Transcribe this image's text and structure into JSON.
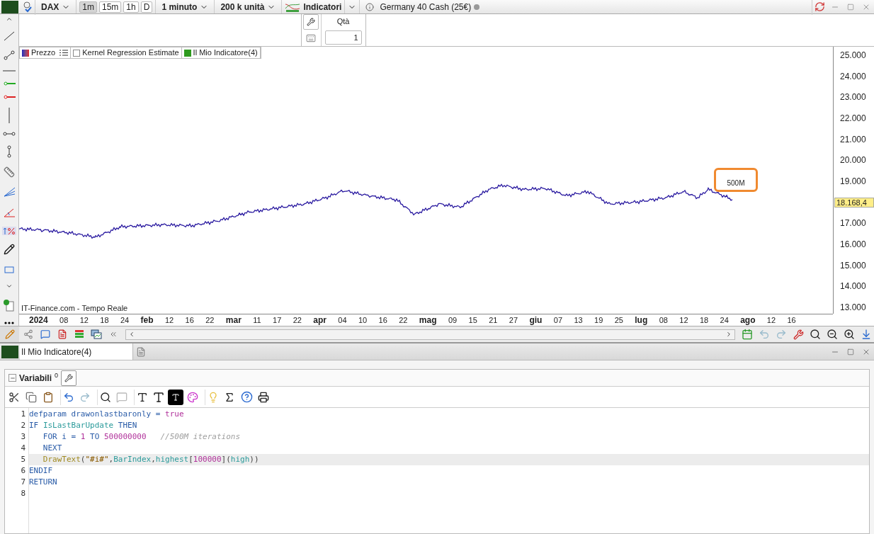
{
  "toolbar": {
    "symbol": "DAX",
    "timeframes": [
      {
        "label": "1m",
        "selected": true
      },
      {
        "label": "15m",
        "selected": false
      },
      {
        "label": "1h",
        "selected": false
      },
      {
        "label": "D",
        "selected": false
      }
    ],
    "interval": "1 minuto",
    "units": "200 k unità",
    "indicators": "Indicatori",
    "instrument": "Germany 40 Cash (25€)"
  },
  "order_panel": {
    "qty_label": "Qtà",
    "qty_value": "1"
  },
  "legend": [
    {
      "label": "Prezzo",
      "kind": "price"
    },
    {
      "label": "Kernel Regression Estimate",
      "kind": "hidden"
    },
    {
      "label": "Il Mio Indicatore(4)",
      "kind": "indicator",
      "color": "#2e9a1e"
    }
  ],
  "price_axis": [
    "25.000",
    "24.000",
    "23.000",
    "22.000",
    "21.000",
    "20.000",
    "19.000",
    "17.000",
    "16.000",
    "15.000",
    "14.000",
    "13.000"
  ],
  "current_price": "18.168,4",
  "annotation": "500M",
  "source": "IT-Finance.com - Tempo Reale",
  "time_axis": [
    {
      "text": "2024",
      "kind": "month"
    },
    {
      "text": "08",
      "kind": "day"
    },
    {
      "text": "12",
      "kind": "day"
    },
    {
      "text": "18",
      "kind": "day"
    },
    {
      "text": "24",
      "kind": "day"
    },
    {
      "text": "feb",
      "kind": "month"
    },
    {
      "text": "12",
      "kind": "day"
    },
    {
      "text": "16",
      "kind": "day"
    },
    {
      "text": "22",
      "kind": "day"
    },
    {
      "text": "mar",
      "kind": "month"
    },
    {
      "text": "11",
      "kind": "day"
    },
    {
      "text": "17",
      "kind": "day"
    },
    {
      "text": "22",
      "kind": "day"
    },
    {
      "text": "apr",
      "kind": "month"
    },
    {
      "text": "04",
      "kind": "day"
    },
    {
      "text": "10",
      "kind": "day"
    },
    {
      "text": "16",
      "kind": "day"
    },
    {
      "text": "22",
      "kind": "day"
    },
    {
      "text": "mag",
      "kind": "month"
    },
    {
      "text": "09",
      "kind": "day"
    },
    {
      "text": "15",
      "kind": "day"
    },
    {
      "text": "21",
      "kind": "day"
    },
    {
      "text": "27",
      "kind": "day"
    },
    {
      "text": "giu",
      "kind": "month"
    },
    {
      "text": "07",
      "kind": "day"
    },
    {
      "text": "13",
      "kind": "day"
    },
    {
      "text": "19",
      "kind": "day"
    },
    {
      "text": "25",
      "kind": "day"
    },
    {
      "text": "lug",
      "kind": "month"
    },
    {
      "text": "08",
      "kind": "day"
    },
    {
      "text": "12",
      "kind": "day"
    },
    {
      "text": "18",
      "kind": "day"
    },
    {
      "text": "24",
      "kind": "day"
    },
    {
      "text": "ago",
      "kind": "month"
    },
    {
      "text": "12",
      "kind": "day"
    },
    {
      "text": "16",
      "kind": "day"
    }
  ],
  "editor_window": {
    "title": "Il Mio Indicatore(4)",
    "variables_label": "Variabili",
    "variables_count": "0"
  },
  "code_lines": [
    {
      "number": "1",
      "highlighted": false,
      "tokens": [
        {
          "text": "defparam drawonlastbaronly = ",
          "kind": "keyword"
        },
        {
          "text": "true",
          "kind": "number"
        }
      ]
    },
    {
      "number": "2",
      "highlighted": false,
      "tokens": [
        {
          "text": "IF ",
          "kind": "keyword"
        },
        {
          "text": "IsLastBarUpdate",
          "kind": "builtin"
        },
        {
          "text": " THEN",
          "kind": "keyword"
        }
      ]
    },
    {
      "number": "3",
      "highlighted": false,
      "tokens": [
        {
          "text": "   FOR i = ",
          "kind": "keyword"
        },
        {
          "text": "1",
          "kind": "number"
        },
        {
          "text": " TO ",
          "kind": "keyword"
        },
        {
          "text": "500000000",
          "kind": "number"
        },
        {
          "text": "   //500M iterations",
          "kind": "comment"
        }
      ]
    },
    {
      "number": "4",
      "highlighted": false,
      "tokens": [
        {
          "text": "   NEXT",
          "kind": "keyword"
        }
      ]
    },
    {
      "number": "5",
      "highlighted": true,
      "tokens": [
        {
          "text": "   DrawText",
          "kind": "function"
        },
        {
          "text": "(",
          "kind": "plain"
        },
        {
          "text": "\"#i#\"",
          "kind": "string"
        },
        {
          "text": ",",
          "kind": "plain"
        },
        {
          "text": "BarIndex",
          "kind": "builtin"
        },
        {
          "text": ",",
          "kind": "plain"
        },
        {
          "text": "highest",
          "kind": "builtin"
        },
        {
          "text": "[",
          "kind": "plain"
        },
        {
          "text": "100000",
          "kind": "number"
        },
        {
          "text": "](",
          "kind": "plain"
        },
        {
          "text": "high",
          "kind": "builtin"
        },
        {
          "text": "))",
          "kind": "plain"
        }
      ]
    },
    {
      "number": "6",
      "highlighted": false,
      "tokens": [
        {
          "text": "ENDIF",
          "kind": "keyword"
        }
      ]
    },
    {
      "number": "7",
      "highlighted": false,
      "tokens": [
        {
          "text": "RETURN",
          "kind": "keyword"
        }
      ]
    },
    {
      "number": "8",
      "highlighted": false
    }
  ]
}
